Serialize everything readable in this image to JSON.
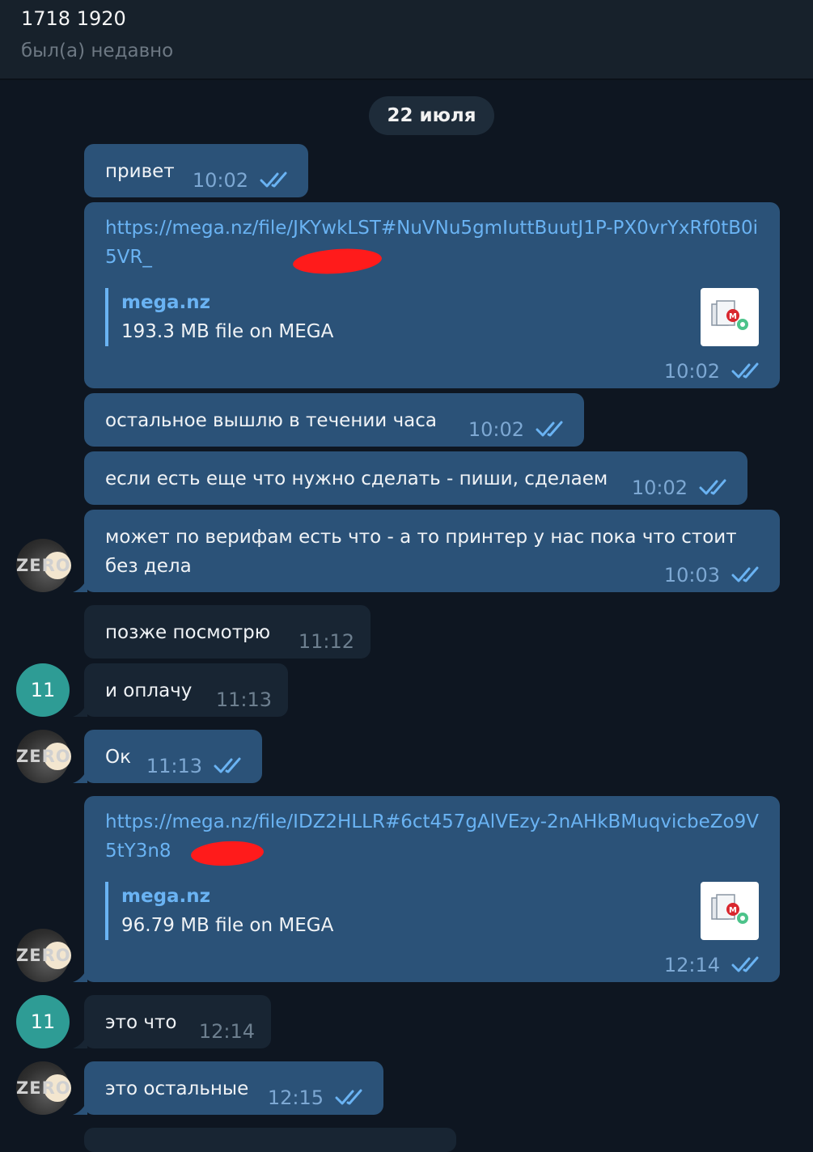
{
  "header": {
    "title": "1718 1920",
    "status": "был(а) недавно"
  },
  "date_separator": "22 июля",
  "messages": [
    {
      "text": "привет",
      "time": "10:02"
    },
    {
      "link": "https://mega.nz/file/JKYwkLST#NuVNu5gmIuttBuutJ1P-PX0vrYxRf0tB0i5VR_",
      "preview_site": "mega.nz",
      "preview_desc": "193.3 MB file on MEGA",
      "time": "10:02"
    },
    {
      "text": "остальное вышлю в течении часа",
      "time": "10:02"
    },
    {
      "text": "если есть еще что нужно сделать - пиши, сделаем",
      "time": "10:02"
    },
    {
      "line1": "может по верифам есть что - а то принтер у нас пока что стоит",
      "line2": "без дела",
      "time": "10:03"
    },
    {
      "text": "позже посмотрю",
      "time": "11:12"
    },
    {
      "text": "и оплачу",
      "time": "11:13"
    },
    {
      "text": "Ок",
      "time": "11:13"
    },
    {
      "link": "https://mega.nz/file/IDZ2HLLR#6ct457gAlVEzy-2nAHkBMuqvicbeZo9V5tY3n8",
      "preview_site": "mega.nz",
      "preview_desc": "96.79 MB file on MEGA",
      "time": "12:14"
    },
    {
      "text": "это что",
      "time": "12:14"
    },
    {
      "text": "это остальные",
      "time": "12:15"
    }
  ],
  "avatars": {
    "zero_label": "ZERO",
    "user_label": "11"
  },
  "colors": {
    "outgoing_bubble": "#2b5278",
    "incoming_bubble": "#182533",
    "link": "#6ab3f3",
    "background": "#0e1621",
    "avatar_user": "#2e9c95",
    "redaction": "#ff1b1b"
  },
  "icons": {
    "read_receipt": "double-check-icon",
    "preview_thumbnail": "mega-file-icon"
  }
}
